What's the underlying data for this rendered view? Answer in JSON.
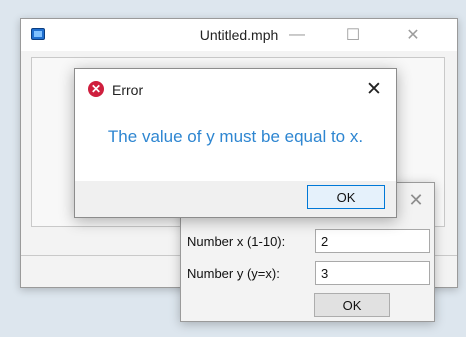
{
  "main_window": {
    "title": "Untitled.mph",
    "minimize_icon": "minimize-icon",
    "maximize_icon": "maximize-icon",
    "close_icon": "close-icon",
    "minimize_glyph": "—",
    "maximize_glyph": "☐",
    "close_glyph": "✕"
  },
  "input_dialog": {
    "close_glyph": "✕",
    "x_label": "Number x (1-10):",
    "x_value": "2",
    "y_label": "Number y (y=x):",
    "y_value": "3",
    "ok_label": "OK"
  },
  "error_dialog": {
    "title": "Error",
    "icon": "error-icon",
    "icon_glyph": "✕",
    "close_glyph": "✕",
    "message": "The value of y must be equal to x.",
    "ok_label": "OK",
    "message_color": "#2e86d1",
    "icon_color": "#cf1f3e"
  }
}
